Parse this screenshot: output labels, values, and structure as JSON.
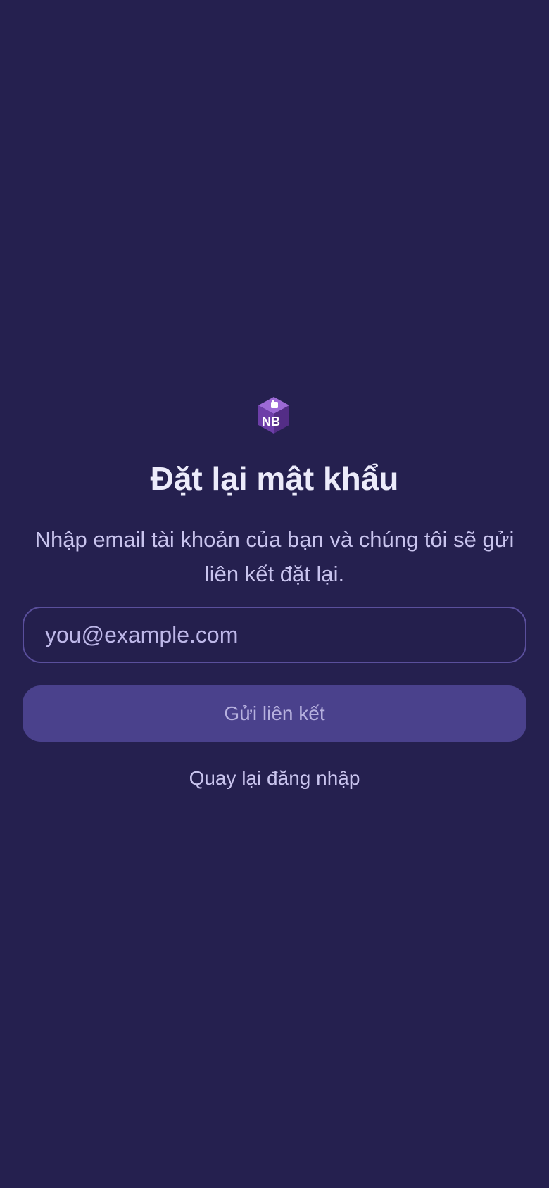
{
  "logo": {
    "icon": "nb-cube-logo-icon",
    "text": "NB"
  },
  "page": {
    "title": "Đặt lại mật khẩu",
    "subtitle": "Nhập email tài khoản của bạn và chúng tôi sẽ gửi liên kết đặt lại."
  },
  "form": {
    "email_value": "",
    "email_placeholder": "you@example.com",
    "submit_label": "Gửi liên kết",
    "back_label": "Quay lại đăng nhập"
  },
  "colors": {
    "background": "#25204f",
    "button": "#4a418c",
    "input_border": "#5a4f9c",
    "logo_purple": "#6d3ea8",
    "text_primary": "#ecebfa",
    "text_secondary": "#c9c4ee"
  }
}
